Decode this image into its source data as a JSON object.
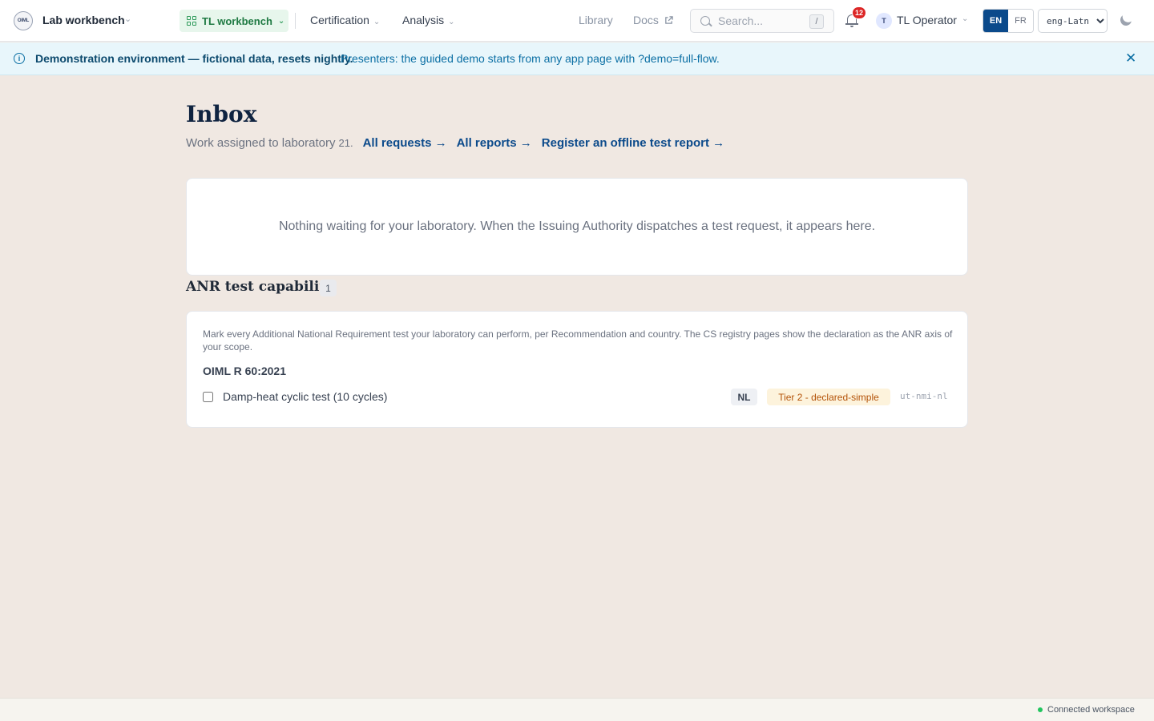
{
  "nav": {
    "logo_text": "OIML",
    "app_name": "Lab workbench",
    "workspace": "TL workbench",
    "menus": [
      "Certification",
      "Analysis"
    ],
    "links": {
      "library": "Library",
      "docs": "Docs"
    },
    "search": {
      "placeholder": "Search...",
      "shortcut": "/"
    },
    "notifications": "12",
    "user": {
      "initial": "T",
      "name": "TL Operator"
    },
    "languages": {
      "active": "EN",
      "other": "FR"
    },
    "script": "eng-Latn",
    "icons": [
      "logo-icon",
      "grid-icon",
      "chevron-down-icon",
      "external-link-icon",
      "search-icon",
      "bell-icon",
      "moon-icon"
    ]
  },
  "banner": {
    "strong": "Demonstration environment — fictional data, resets nightly.",
    "text": "Presenters: the guided demo starts from any app page with ?demo=full-flow.",
    "icons": [
      "info-icon",
      "close-icon"
    ]
  },
  "main": {
    "title": "Inbox",
    "subtitle": "Work assigned to laboratory",
    "lab_number": "21.",
    "links": [
      "All requests →",
      "All reports →",
      "Register an offline test report →"
    ],
    "empty_message": "Nothing waiting for your laboratory. When the Issuing Authority dispatches a test request, it appears here."
  },
  "anr": {
    "title": "ANR test capability",
    "count": "1",
    "description": "Mark every Additional National Requirement test your laboratory can perform, per Recommendation and country. The CS registry pages show the declaration as the ANR axis of your scope.",
    "recommendation": "OIML R 60:2021",
    "tests": [
      {
        "label": "Damp-heat cyclic test (10 cycles)",
        "country": "NL",
        "tier": "Tier 2 - declared-simple",
        "code": "ut-nmi-nl",
        "checked": false
      }
    ]
  },
  "footer": {
    "status": "Connected workspace",
    "status_color": "#22c55e"
  }
}
